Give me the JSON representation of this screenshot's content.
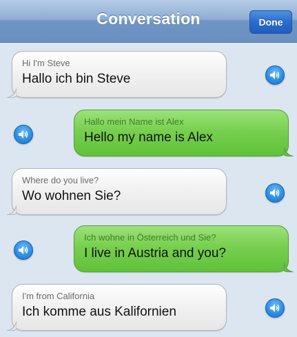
{
  "header": {
    "title": "Conversation",
    "done_label": "Done"
  },
  "messages": [
    {
      "side": "left",
      "style": "grey",
      "original": "Hi I'm Steve",
      "translation": "Hallo ich bin Steve"
    },
    {
      "side": "right",
      "style": "green",
      "original": "Hallo mein Name ist Alex",
      "translation": "Hello my name is Alex"
    },
    {
      "side": "left",
      "style": "grey",
      "original": "Where do you live?",
      "translation": "Wo wohnen Sie?"
    },
    {
      "side": "right",
      "style": "green",
      "original": "Ich wohne in Österreich und Sie?",
      "translation": "I live in Austria and you?"
    },
    {
      "side": "left",
      "style": "grey",
      "original": "I'm from California",
      "translation": "Ich komme aus Kalifornien"
    }
  ],
  "colors": {
    "nav_bar": "#7f9fcb",
    "done_button": "#2a6cd0",
    "background": "#dbe6f1",
    "bubble_grey": "#eeeeee",
    "bubble_green": "#78cf4f",
    "speaker_button": "#2f8fe6"
  },
  "icons": {
    "speaker": "speaker-icon"
  }
}
